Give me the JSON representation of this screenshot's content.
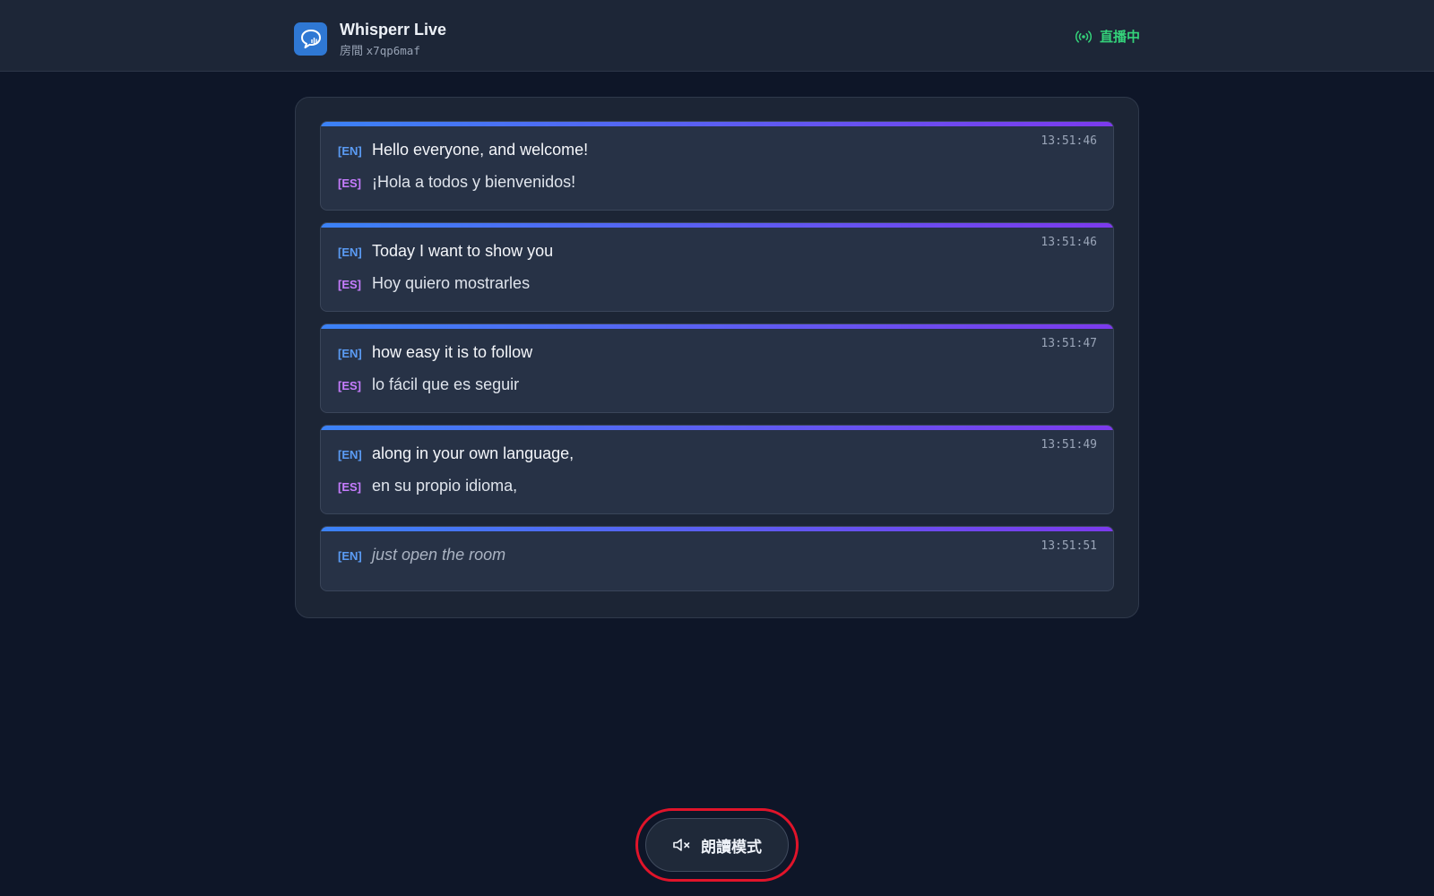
{
  "header": {
    "app_title": "Whisperr Live",
    "room_label": "房間",
    "room_id": "x7qp6maf",
    "live_status": "直播中",
    "logo_icon": "chat-bubble-waveform-icon",
    "live_icon": "broadcast-icon"
  },
  "colors": {
    "accent_blue": "#3b82f6",
    "accent_purple": "#7c3aed",
    "live_green": "#34d27a",
    "en_tag": "#5b9cf5",
    "es_tag": "#c77dff",
    "highlight_ring": "#e0142a"
  },
  "transcript": [
    {
      "timestamp": "13:51:46",
      "source_tag": "[EN]",
      "source_text": "Hello everyone, and welcome!",
      "target_tag": "[ES]",
      "target_text": "¡Hola a todos y bienvenidos!"
    },
    {
      "timestamp": "13:51:46",
      "source_tag": "[EN]",
      "source_text": "Today I want to show you",
      "target_tag": "[ES]",
      "target_text": "Hoy quiero mostrarles"
    },
    {
      "timestamp": "13:51:47",
      "source_tag": "[EN]",
      "source_text": "how easy it is to follow",
      "target_tag": "[ES]",
      "target_text": "lo fácil que es seguir"
    },
    {
      "timestamp": "13:51:49",
      "source_tag": "[EN]",
      "source_text": "along in your own language,",
      "target_tag": "[ES]",
      "target_text": "en su propio idioma,"
    },
    {
      "timestamp": "13:51:51",
      "source_tag": "[EN]",
      "source_text": "just open the room"
    }
  ],
  "read_aloud": {
    "label": "朗讀模式",
    "icon": "speaker-muted-icon"
  }
}
